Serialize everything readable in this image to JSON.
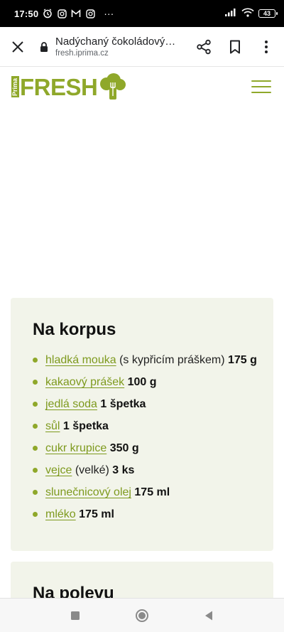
{
  "status_bar": {
    "time": "17:50",
    "battery": "43",
    "icons": [
      "alarm-icon",
      "instagram-icon",
      "gmail-icon",
      "instagram-icon",
      "more-dots-icon",
      "signal-icon",
      "wifi-icon",
      "battery-icon"
    ],
    "more": "···"
  },
  "browser": {
    "page_title": "Nadýchaný čokoládový ...",
    "domain": "fresh.iprima.cz"
  },
  "site": {
    "logo_small": "Prima",
    "logo_main": "FRESH"
  },
  "colors": {
    "accent": "#8fa82a",
    "link": "#7e9a1e",
    "card_bg": "#f2f4ea"
  },
  "section_korpus": {
    "title": "Na korpus",
    "items": [
      {
        "link": "hladká mouka",
        "note": "(s kypřicím práškem)",
        "amount": "175 g"
      },
      {
        "link": "kakaový prášek",
        "note": "",
        "amount": "100 g"
      },
      {
        "link": "jedlá soda",
        "note": "",
        "amount": "1 špetka"
      },
      {
        "link": "sůl",
        "note": "",
        "amount": "1 špetka"
      },
      {
        "link": "cukr krupice",
        "note": "",
        "amount": "350 g"
      },
      {
        "link": "vejce",
        "note": "(velké)",
        "amount": "3 ks"
      },
      {
        "link": "slunečnicový olej",
        "note": "",
        "amount": "175 ml"
      },
      {
        "link": "mléko",
        "note": "",
        "amount": "175 ml"
      }
    ]
  },
  "section_poleva": {
    "title": "Na polevu"
  }
}
